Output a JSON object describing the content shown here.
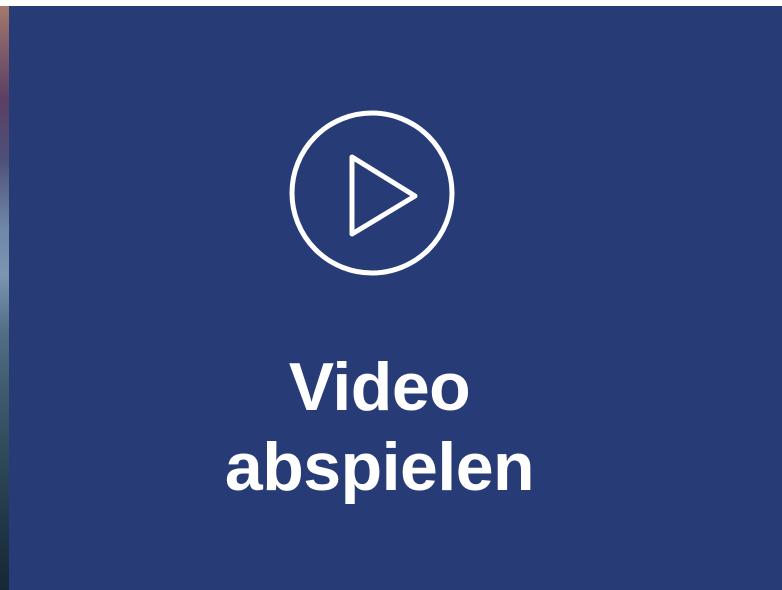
{
  "video_overlay": {
    "icon": "play-circle-icon",
    "label_line1": "Video",
    "label_line2": "abspielen",
    "background_color": "#273b76",
    "foreground_color": "#ffffff"
  }
}
